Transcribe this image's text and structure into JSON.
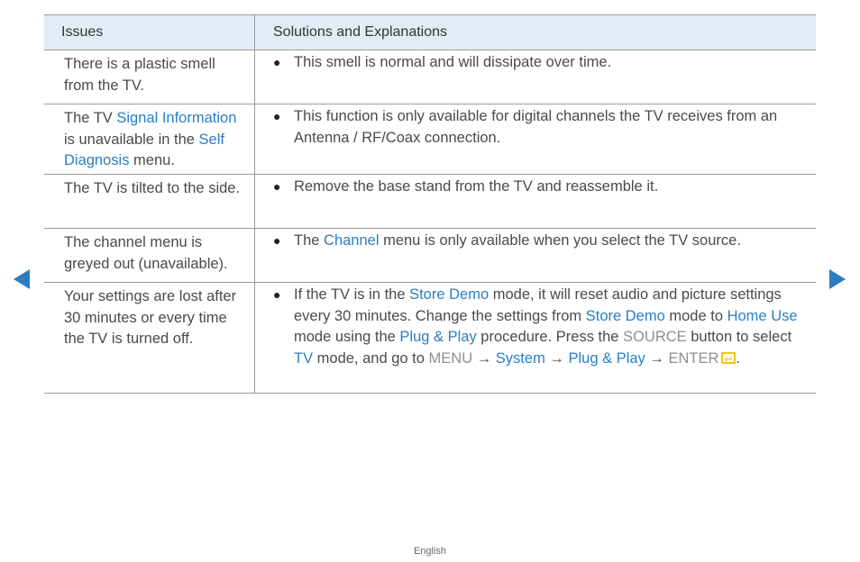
{
  "table": {
    "header": {
      "issues": "Issues",
      "solutions": "Solutions and Explanations"
    },
    "rows": [
      {
        "issue": [
          {
            "t": "There is a plastic smell from the TV."
          }
        ],
        "solution": [
          {
            "t": "This smell is normal and will dissipate over time."
          }
        ]
      },
      {
        "issue": [
          {
            "t": "The TV "
          },
          {
            "t": "Signal Information",
            "s": "hl"
          },
          {
            "t": " is unavailable in the "
          },
          {
            "t": "Self Diagnosis",
            "s": "hl"
          },
          {
            "t": " menu."
          }
        ],
        "solution": [
          {
            "t": "This function is only available for digital channels the TV receives from an Antenna / RF/Coax connection."
          }
        ]
      },
      {
        "issue": [
          {
            "t": "The TV is tilted to the side."
          }
        ],
        "solution": [
          {
            "t": "Remove the base stand from the TV and reassemble it."
          }
        ]
      },
      {
        "issue": [
          {
            "t": "The channel menu is greyed out (unavailable)."
          }
        ],
        "solution": [
          {
            "t": "The "
          },
          {
            "t": "Channel",
            "s": "hl"
          },
          {
            "t": " menu is only available when you select the TV source."
          }
        ]
      },
      {
        "issue": [
          {
            "t": "Your settings are lost after 30 minutes or every time the TV is turned off."
          }
        ],
        "solution": [
          {
            "t": "If the TV is in the "
          },
          {
            "t": "Store Demo",
            "s": "hl"
          },
          {
            "t": " mode, it will reset audio and picture settings every 30 minutes. Change the settings from "
          },
          {
            "t": "Store Demo",
            "s": "hl"
          },
          {
            "t": " mode to "
          },
          {
            "t": "Home Use",
            "s": "hl"
          },
          {
            "t": " mode using the "
          },
          {
            "t": "Plug & Play",
            "s": "hl"
          },
          {
            "t": " procedure. Press the "
          },
          {
            "t": "SOURCE",
            "s": "gr"
          },
          {
            "t": " button to select "
          },
          {
            "t": "TV",
            "s": "hl"
          },
          {
            "t": " mode, and go to "
          },
          {
            "t": "MENU",
            "s": "gr"
          },
          {
            "t": " → "
          },
          {
            "t": "System",
            "s": "hl"
          },
          {
            "t": " → "
          },
          {
            "t": "Plug & Play",
            "s": "hl"
          },
          {
            "t": " → "
          },
          {
            "t": "ENTER",
            "s": "gr",
            "icon": "enter-icon"
          },
          {
            "t": "."
          }
        ]
      }
    ]
  },
  "nav": {
    "prev_icon": "prev-page-arrow-icon",
    "next_icon": "next-page-arrow-icon"
  },
  "footer": {
    "language": "English"
  },
  "colors": {
    "highlight": "#2a7ec3",
    "menu_grey": "#8e8e8e",
    "header_bg": "#e3ecf6",
    "enter_icon": "#f4c21d"
  }
}
